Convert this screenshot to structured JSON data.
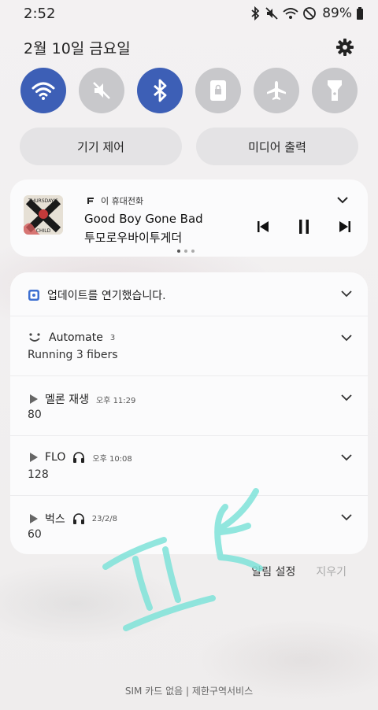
{
  "status_bar": {
    "time": "2:52",
    "battery": "89%",
    "icons": [
      "bluetooth-icon",
      "mute-icon",
      "wifi-icon",
      "dnd-icon",
      "battery-icon"
    ]
  },
  "header": {
    "date": "2월 10일 금요일",
    "settings_icon": "gear-icon"
  },
  "quick_toggles": [
    {
      "name": "wifi",
      "icon": "wifi-icon",
      "on": true
    },
    {
      "name": "sound",
      "icon": "mute-icon",
      "on": false
    },
    {
      "name": "bluetooth",
      "icon": "bluetooth-icon",
      "on": true
    },
    {
      "name": "rotation-lock",
      "icon": "lock-rotation-icon",
      "on": false
    },
    {
      "name": "airplane",
      "icon": "airplane-icon",
      "on": false
    },
    {
      "name": "flashlight",
      "icon": "flashlight-icon",
      "on": false
    }
  ],
  "pills": {
    "device_control": "기기 제어",
    "media_output": "미디어 출력"
  },
  "media": {
    "app_name": "이 휴대전화",
    "title": "Good Boy Gone Bad",
    "artist": "투모로우바이투게더",
    "album_text_top": "THURSDAY'S",
    "album_text_bottom": "CHILD",
    "page_dots": 3,
    "active_dot": 0
  },
  "notifications": [
    {
      "app": "업데이트를 연기했습니다.",
      "time": "",
      "body": "",
      "icon": "calendar-icon"
    },
    {
      "app": "Automate",
      "time": "3",
      "body": "Running 3 fibers",
      "icon": "automate-icon"
    },
    {
      "app": "멜론 재생",
      "time": "오후 11:29",
      "body": "80",
      "icon": "play-icon"
    },
    {
      "app": "FLO",
      "time": "오후 10:08",
      "body": "128",
      "icon": "play-icon",
      "headphones": true
    },
    {
      "app": "벅스",
      "time": "23/2/8",
      "body": "60",
      "icon": "play-icon",
      "headphones": true
    }
  ],
  "footer": {
    "notification_settings": "알림 설정",
    "clear": "지우기",
    "carrier": "SIM 카드 없음 | 제한구역서비스"
  },
  "colors": {
    "accent": "#3d5fb6",
    "toggle_off": "#c8c8cb",
    "scribble": "#7fe3d9"
  }
}
